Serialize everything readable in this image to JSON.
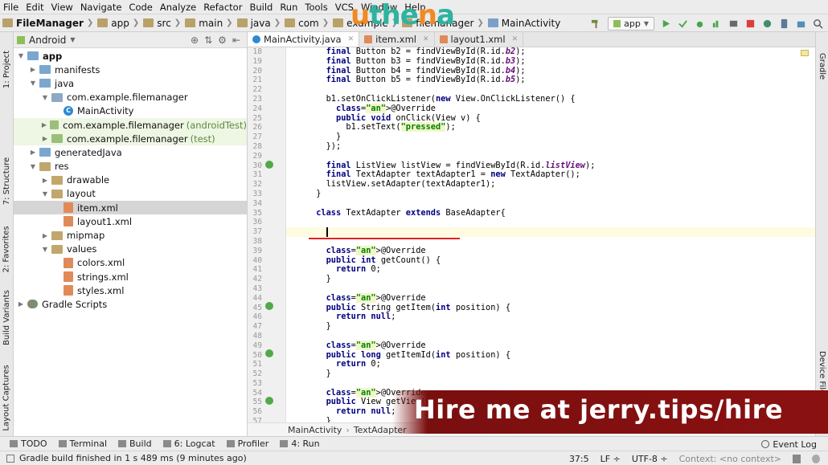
{
  "menu": [
    "File",
    "Edit",
    "View",
    "Navigate",
    "Code",
    "Analyze",
    "Refactor",
    "Build",
    "Run",
    "Tools",
    "VCS",
    "Window",
    "Help"
  ],
  "logo_text": "uthena",
  "nav": {
    "crumbs": [
      "FileManager",
      "app",
      "src",
      "main",
      "java",
      "com",
      "example",
      "filemanager",
      "MainActivity"
    ],
    "run_config": "app"
  },
  "left_tabs": [
    "1: Project",
    "7: Structure",
    "2: Favorites",
    "Build Variants",
    "Layout Captures"
  ],
  "right_tabs": [
    "Gradle",
    "Device File Explorer"
  ],
  "project": {
    "view_mode": "Android",
    "tree": [
      {
        "label": "app",
        "depth": 0,
        "icon": "folder",
        "expanded": true,
        "bold": true
      },
      {
        "label": "manifests",
        "depth": 1,
        "icon": "folder",
        "expanded": false
      },
      {
        "label": "java",
        "depth": 1,
        "icon": "folder",
        "expanded": true
      },
      {
        "label": "com.example.filemanager",
        "depth": 2,
        "icon": "package",
        "expanded": true
      },
      {
        "label": "MainActivity",
        "depth": 3,
        "icon": "class",
        "expanded": null
      },
      {
        "label": "com.example.filemanager",
        "suffix": "(androidTest)",
        "depth": 2,
        "icon": "package",
        "expanded": false,
        "test": true
      },
      {
        "label": "com.example.filemanager",
        "suffix": "(test)",
        "depth": 2,
        "icon": "package",
        "expanded": false,
        "test": true
      },
      {
        "label": "generatedJava",
        "depth": 1,
        "icon": "folder",
        "expanded": false
      },
      {
        "label": "res",
        "depth": 1,
        "icon": "res",
        "expanded": true
      },
      {
        "label": "drawable",
        "depth": 2,
        "icon": "res",
        "expanded": false
      },
      {
        "label": "layout",
        "depth": 2,
        "icon": "res",
        "expanded": true
      },
      {
        "label": "item.xml",
        "depth": 3,
        "icon": "xml",
        "expanded": null,
        "selected": true
      },
      {
        "label": "layout1.xml",
        "depth": 3,
        "icon": "xml",
        "expanded": null
      },
      {
        "label": "mipmap",
        "depth": 2,
        "icon": "res",
        "expanded": false
      },
      {
        "label": "values",
        "depth": 2,
        "icon": "res",
        "expanded": true
      },
      {
        "label": "colors.xml",
        "depth": 3,
        "icon": "xml",
        "expanded": null
      },
      {
        "label": "strings.xml",
        "depth": 3,
        "icon": "xml",
        "expanded": null
      },
      {
        "label": "styles.xml",
        "depth": 3,
        "icon": "xml",
        "expanded": null
      },
      {
        "label": "Gradle Scripts",
        "depth": 0,
        "icon": "gradle",
        "expanded": false
      }
    ]
  },
  "tabs": [
    {
      "label": "MainActivity.java",
      "kind": "java",
      "active": true
    },
    {
      "label": "item.xml",
      "kind": "xml",
      "active": false
    },
    {
      "label": "layout1.xml",
      "kind": "xml",
      "active": false
    }
  ],
  "code_lines": [
    {
      "n": "18",
      "text": "        final Button b2 = findViewById(R.id.b2);"
    },
    {
      "n": "19",
      "text": "        final Button b3 = findViewById(R.id.b3);"
    },
    {
      "n": "20",
      "text": "        final Button b4 = findViewById(R.id.b4);"
    },
    {
      "n": "21",
      "text": "        final Button b5 = findViewById(R.id.b5);"
    },
    {
      "n": "22",
      "text": ""
    },
    {
      "n": "23",
      "text": "        b1.setOnClickListener(new View.OnClickListener() {"
    },
    {
      "n": "24",
      "text": "          @Override"
    },
    {
      "n": "25",
      "text": "          public void onClick(View v) {"
    },
    {
      "n": "26",
      "text": "            b1.setText(\"pressed\");"
    },
    {
      "n": "27",
      "text": "          }"
    },
    {
      "n": "28",
      "text": "        });"
    },
    {
      "n": "29",
      "text": ""
    },
    {
      "n": "30",
      "text": "        final ListView listView = findViewById(R.id.listView);"
    },
    {
      "n": "31",
      "text": "        final TextAdapter textAdapter1 = new TextAdapter();"
    },
    {
      "n": "32",
      "text": "        listView.setAdapter(textAdapter1);"
    },
    {
      "n": "33",
      "text": "      }"
    },
    {
      "n": "34",
      "text": ""
    },
    {
      "n": "35",
      "text": "      class TextAdapter extends BaseAdapter{"
    },
    {
      "n": "36",
      "text": ""
    },
    {
      "n": "37",
      "text": "        "
    },
    {
      "n": "38",
      "text": ""
    },
    {
      "n": "39",
      "text": "        @Override"
    },
    {
      "n": "40",
      "text": "        public int getCount() {"
    },
    {
      "n": "41",
      "text": "          return 0;"
    },
    {
      "n": "42",
      "text": "        }"
    },
    {
      "n": "43",
      "text": ""
    },
    {
      "n": "44",
      "text": "        @Override"
    },
    {
      "n": "45",
      "text": "        public String getItem(int position) {"
    },
    {
      "n": "46",
      "text": "          return null;"
    },
    {
      "n": "47",
      "text": "        }"
    },
    {
      "n": "48",
      "text": ""
    },
    {
      "n": "49",
      "text": "        @Override"
    },
    {
      "n": "50",
      "text": "        public long getItemId(int position) {"
    },
    {
      "n": "51",
      "text": "          return 0;"
    },
    {
      "n": "52",
      "text": "        }"
    },
    {
      "n": "53",
      "text": ""
    },
    {
      "n": "54",
      "text": "        @Override"
    },
    {
      "n": "55",
      "text": "        public View getView(in"
    },
    {
      "n": "56",
      "text": "          return null;"
    },
    {
      "n": "57",
      "text": "        }"
    }
  ],
  "editor_breadcrumb": [
    "MainActivity",
    "TextAdapter"
  ],
  "banner_text": "Hire me at jerry.tips/hire",
  "bottom_tools": [
    {
      "label": "TODO",
      "key": ""
    },
    {
      "label": "Terminal",
      "key": ""
    },
    {
      "label": "Build",
      "key": ""
    },
    {
      "label": "6: Logcat",
      "key": "6"
    },
    {
      "label": "Profiler",
      "key": ""
    },
    {
      "label": "4: Run",
      "key": "4"
    }
  ],
  "event_log": "Event Log",
  "status": {
    "message": "Gradle build finished in 1 s 489 ms (9 minutes ago)",
    "position": "37:5",
    "line_sep": "LF ÷",
    "encoding": "UTF-8 ÷",
    "context_label": "Context:",
    "context_value": "<no context>"
  },
  "colors": {
    "accent": "#2e89d0",
    "banner": "#8b1111",
    "underline": "#e0221a",
    "logo_orange": "#f08a24",
    "logo_teal": "#2db3a0"
  }
}
